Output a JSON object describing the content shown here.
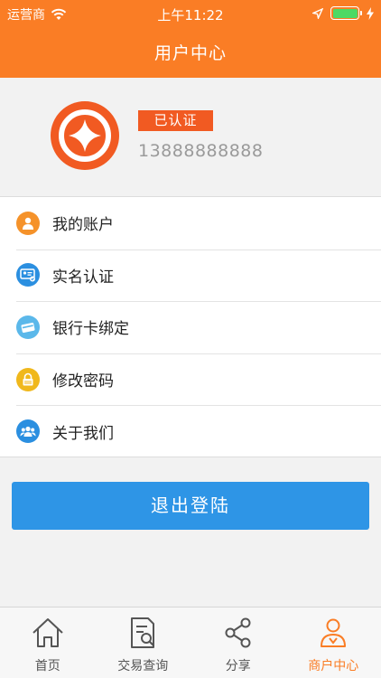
{
  "status_bar": {
    "carrier": "运营商",
    "time": "上午11:22"
  },
  "header": {
    "title": "用户中心"
  },
  "profile": {
    "verified_badge": "已认证",
    "phone": "13888888888"
  },
  "menu": {
    "items": [
      {
        "label": "我的账户",
        "icon": "account-icon",
        "color": "#f5922a"
      },
      {
        "label": "实名认证",
        "icon": "id-card-icon",
        "color": "#2b8fe0"
      },
      {
        "label": "银行卡绑定",
        "icon": "bank-card-icon",
        "color": "#5bb8ea"
      },
      {
        "label": "修改密码",
        "icon": "lock-icon",
        "color": "#f0b81c"
      },
      {
        "label": "关于我们",
        "icon": "people-icon",
        "color": "#2b8fe0"
      }
    ]
  },
  "logout_label": "退出登陆",
  "tabbar": {
    "tabs": [
      {
        "label": "首页",
        "icon": "home-icon"
      },
      {
        "label": "交易查询",
        "icon": "document-search-icon"
      },
      {
        "label": "分享",
        "icon": "share-icon"
      },
      {
        "label": "商户中心",
        "icon": "user-icon",
        "active": true
      }
    ]
  },
  "colors": {
    "brand": "#fa7d25",
    "badge": "#f15a22",
    "button": "#2e95e6"
  }
}
